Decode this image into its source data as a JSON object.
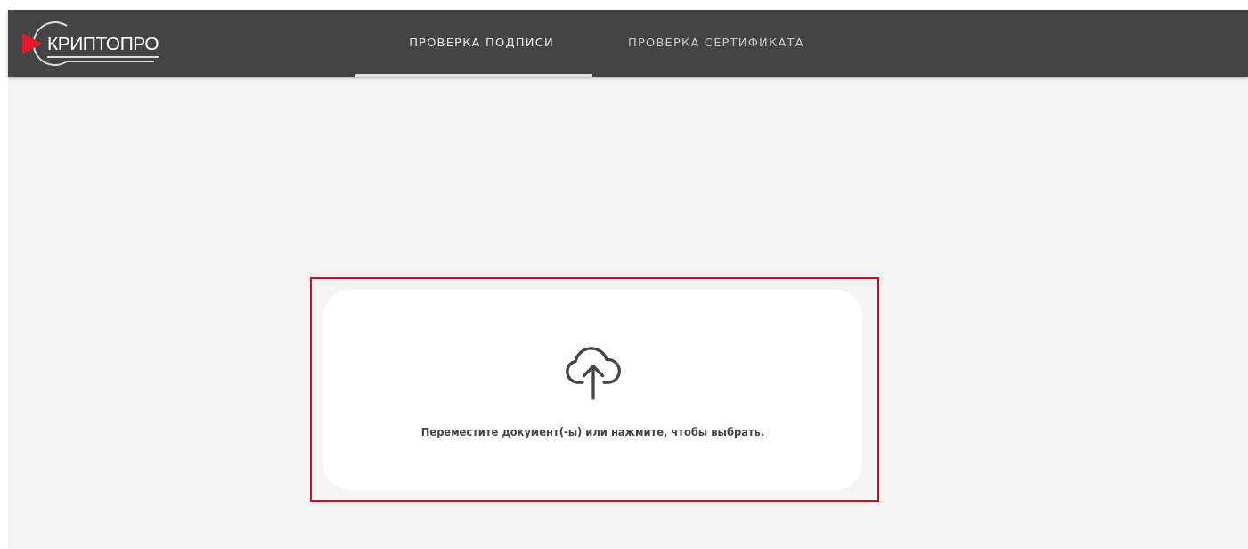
{
  "header": {
    "logo": {
      "text": "КРИПТОПРО"
    },
    "tabs": [
      {
        "label": "ПРОВЕРКА ПОДПИСИ",
        "selected": true
      },
      {
        "label": "ПРОВЕРКА СЕРТИФИКАТА",
        "selected": false
      }
    ]
  },
  "dropzone": {
    "highlighted": true,
    "text": "Переместите документ(-ы) или нажмите, чтобы выбрать."
  }
}
